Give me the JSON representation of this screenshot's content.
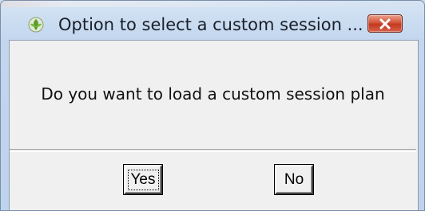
{
  "window": {
    "title": "Option to select a custom session ...",
    "icons": {
      "app": "app-leaf-icon",
      "close": "close-x-icon"
    },
    "colors": {
      "close_button": "#c8452b",
      "client_bg": "#f0f0f0"
    }
  },
  "dialog": {
    "message": "Do you want to load a custom session plan",
    "buttons": {
      "yes_label": "Yes",
      "no_label": "No"
    }
  }
}
